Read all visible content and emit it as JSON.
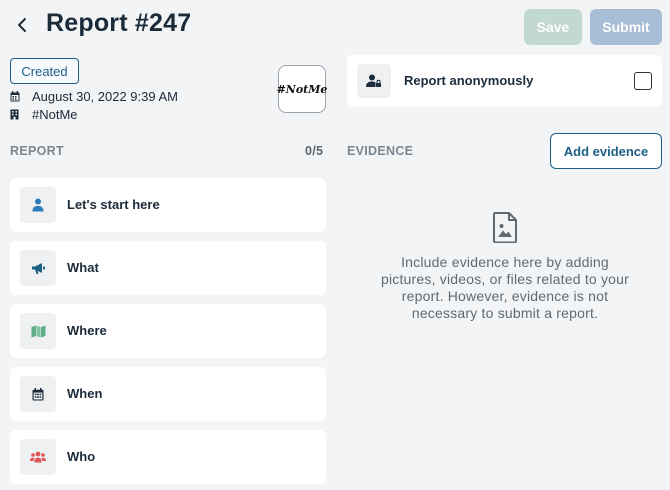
{
  "header": {
    "title": "Report #247",
    "save_label": "Save",
    "submit_label": "Submit"
  },
  "meta": {
    "status": "Created",
    "date": "August 30, 2022 9:39 AM",
    "organization": "#NotMe",
    "logo_text": "#NotMe"
  },
  "anonymous": {
    "label": "Report anonymously",
    "checked": false
  },
  "report": {
    "section_label": "REPORT",
    "progress": "0/5",
    "items": [
      {
        "label": "Let's start here",
        "icon": "person-icon"
      },
      {
        "label": "What",
        "icon": "megaphone-icon"
      },
      {
        "label": "Where",
        "icon": "map-icon"
      },
      {
        "label": "When",
        "icon": "calendar-icon"
      },
      {
        "label": "Who",
        "icon": "people-icon"
      }
    ]
  },
  "evidence": {
    "section_label": "EVIDENCE",
    "add_label": "Add evidence",
    "empty_text": "Include evidence here by adding pictures, videos, or files related to your report. However, evidence is not necessary to submit a report."
  },
  "colors": {
    "primary": "#1f5f86",
    "save_disabled": "#c1d9cf",
    "submit_disabled": "#a8bed6",
    "person_icon": "#2b7bb9",
    "megaphone_icon": "#1f5f86",
    "map_icon": "#5fae88",
    "calendar_icon": "#1c2b3a",
    "people_icon": "#e05555"
  }
}
